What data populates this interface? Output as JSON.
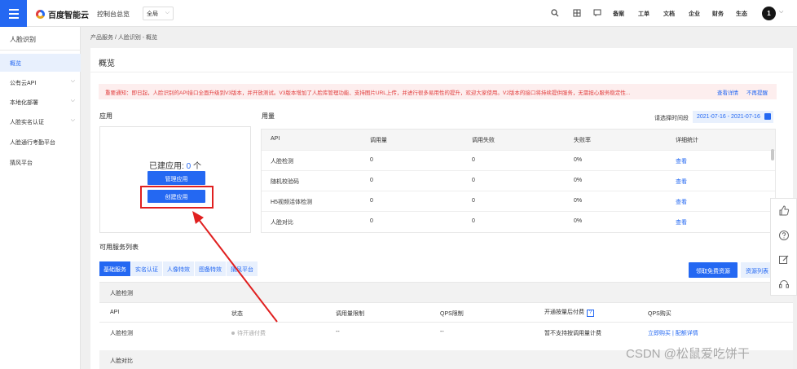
{
  "header": {
    "brand": "百度智能云",
    "console_label": "控制台总览",
    "region": "全局",
    "nav": [
      "备案",
      "工单",
      "文档",
      "企业",
      "财务",
      "生态"
    ],
    "avatar_text": "1"
  },
  "sidebar": {
    "title": "人脸识别",
    "items": [
      {
        "label": "概览",
        "active": true,
        "expandable": false
      },
      {
        "label": "公有云API",
        "active": false,
        "expandable": true
      },
      {
        "label": "本地化部署",
        "active": false,
        "expandable": true
      },
      {
        "label": "人脸实名认证",
        "active": false,
        "expandable": true
      },
      {
        "label": "人脸通行考勤平台",
        "active": false,
        "expandable": false
      },
      {
        "label": "猜风平台",
        "active": false,
        "expandable": false
      }
    ]
  },
  "breadcrumb": "产品服务 / 人脸识别 - 概览",
  "page_title": "概览",
  "notice": {
    "text": "重要通知：即日起，人脸识别的API接口全面升级到V3版本，并开放测试。V3版本增加了人脸库管理功能、支持图片URL上传，并进行很多易用性的提升，欢迎大家使用。V2版本的接口将持续提供服务，无需担心服务稳定性...",
    "details_link": "查看详情",
    "dismiss_link": "不再提醒"
  },
  "apps": {
    "heading": "应用",
    "created_label": "已建应用:",
    "count": "0",
    "unit": "个",
    "manage_button": "管理应用",
    "create_button": "创建应用"
  },
  "usage": {
    "heading": "用量",
    "date_label": "请选择时间段",
    "date_range": "2021-07-16 - 2021-07-16",
    "columns": [
      "API",
      "调用量",
      "调用失败",
      "失败率",
      "详细统计"
    ],
    "rows": [
      {
        "api": "人脸检测",
        "calls": "0",
        "failures": "0",
        "rate": "0%",
        "action": "查看"
      },
      {
        "api": "随机校验码",
        "calls": "0",
        "failures": "0",
        "rate": "0%",
        "action": "查看"
      },
      {
        "api": "H5视频活体检测",
        "calls": "0",
        "failures": "0",
        "rate": "0%",
        "action": "查看"
      },
      {
        "api": "人脸对比",
        "calls": "0",
        "failures": "0",
        "rate": "0%",
        "action": "查看"
      }
    ]
  },
  "services": {
    "heading": "可用服务列表",
    "tabs": [
      "基础服务",
      "实名认证",
      "人像特效",
      "图备特效",
      "猜风平台"
    ],
    "free_button": "领取免费资源",
    "resource_button": "资源列表",
    "groups": [
      {
        "name": "人脸检测",
        "columns": [
          "API",
          "状态",
          "调用量限制",
          "QPS限制",
          "开通按量后付费",
          "QPS购买"
        ],
        "help_badge": "?",
        "rows": [
          {
            "api": "人脸检测",
            "status": "待开通付费",
            "call_limit": "--",
            "qps_limit": "--",
            "postpaid": "暂不支持按调用量计费",
            "buy_link": "立即购买",
            "separator": "|",
            "config_link": "配额详情"
          }
        ]
      },
      {
        "name": "人脸对比"
      }
    ]
  },
  "floating_tools": [
    "thumbs-up-icon",
    "help-icon",
    "edit-icon",
    "headset-icon"
  ],
  "watermark": "CSDN @松鼠爱吃饼干",
  "colors": {
    "primary": "#2468f2",
    "alert": "#e13d3d",
    "annotation": "#e02020"
  }
}
